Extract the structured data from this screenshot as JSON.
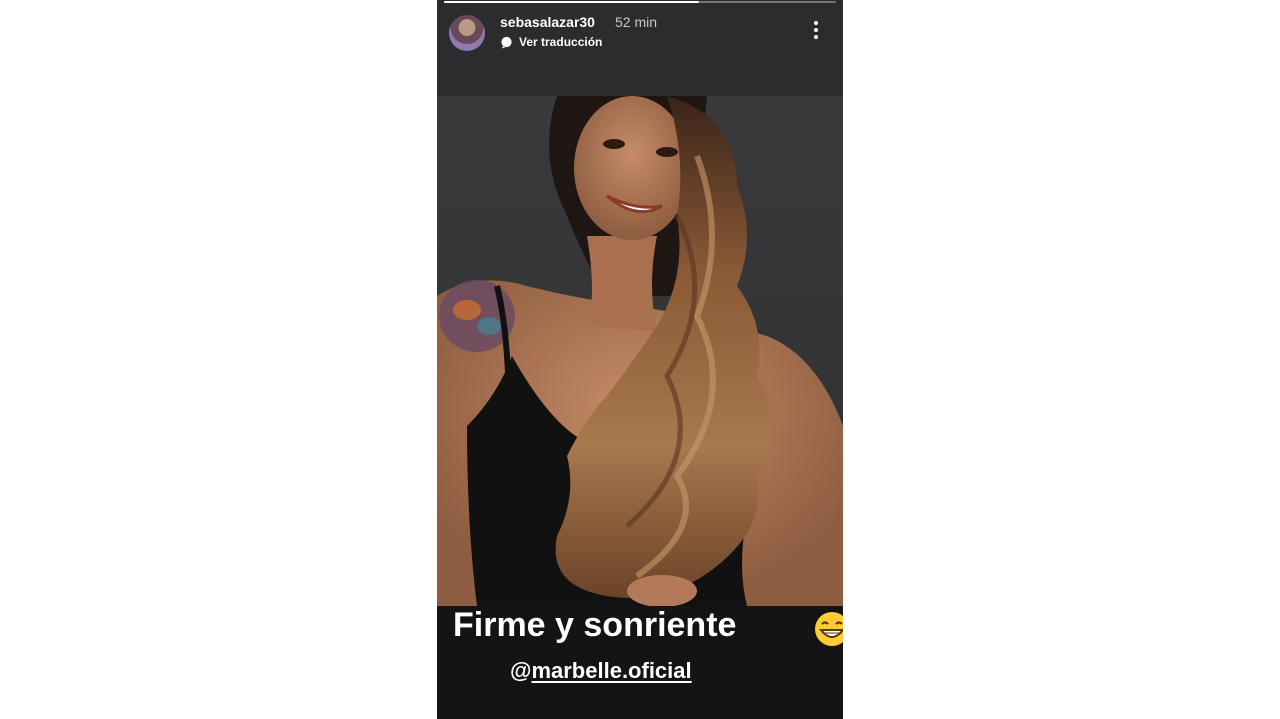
{
  "story": {
    "progress": 0.65,
    "username": "sebasalazar30",
    "time": "52 min",
    "translate_label": "Ver traducción",
    "more_icon": "more-vertical-icon",
    "avatar_icon": "avatar"
  },
  "caption": {
    "text": "Firme y sonriente",
    "emoji": "grinning-face-emoji"
  },
  "mention": {
    "at": "@",
    "name": "marbelle.oficial"
  },
  "colors": {
    "story_bg": "#2b2b2d",
    "caption_bg": "#141414",
    "text": "#ffffff"
  }
}
